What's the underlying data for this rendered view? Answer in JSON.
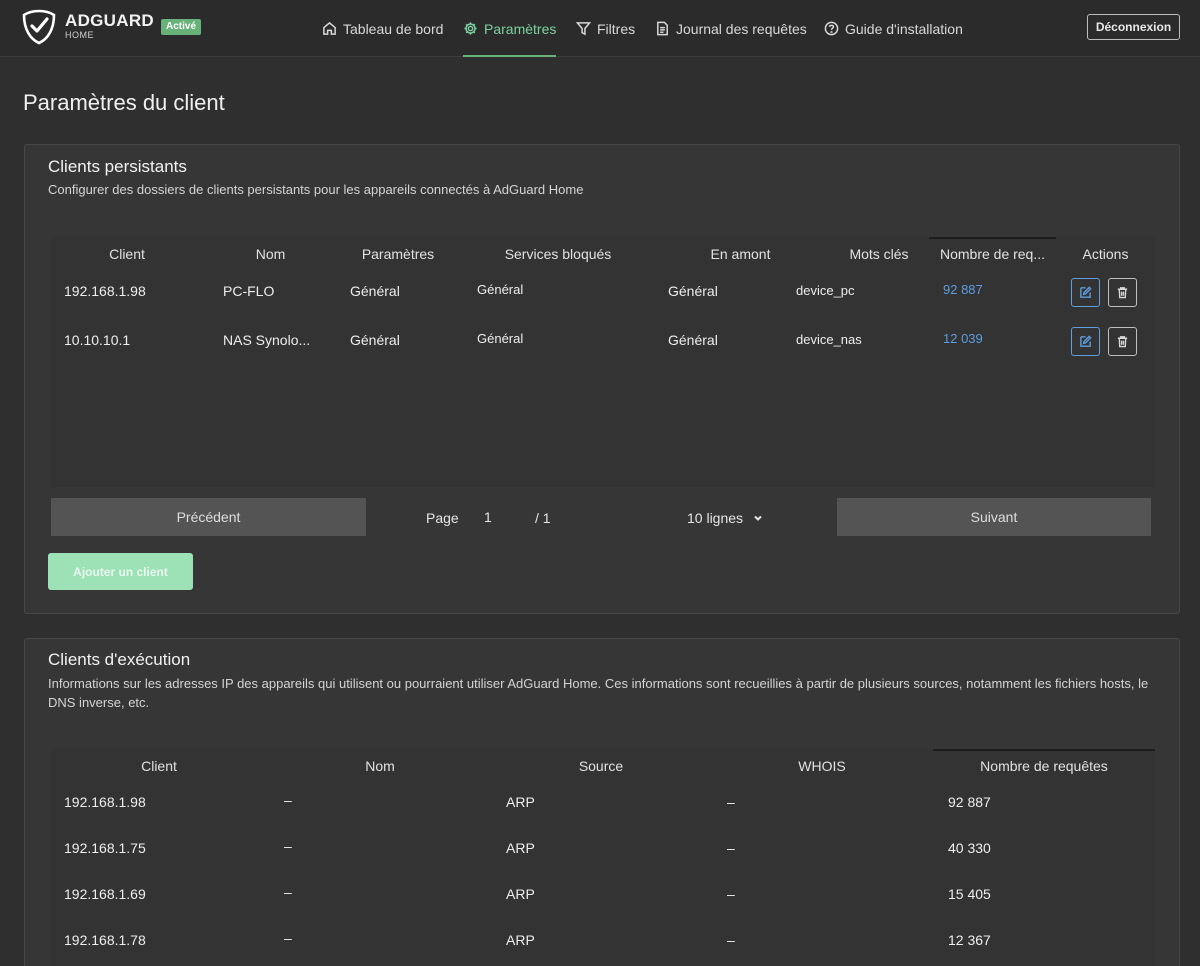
{
  "header": {
    "brand_name": "ADGUARD",
    "brand_sub": "HOME",
    "status_badge": "Activé",
    "nav": [
      {
        "label": "Tableau de bord",
        "icon": "home-icon"
      },
      {
        "label": "Paramètres",
        "icon": "gear-icon",
        "active": true
      },
      {
        "label": "Filtres",
        "icon": "filter-icon"
      },
      {
        "label": "Journal des requêtes",
        "icon": "document-icon"
      },
      {
        "label": "Guide d'installation",
        "icon": "help-icon"
      }
    ],
    "logout_label": "Déconnexion"
  },
  "page_title": "Paramètres du client",
  "persistent": {
    "title": "Clients persistants",
    "description": "Configurer des dossiers de clients persistants pour les appareils connectés à AdGuard Home",
    "columns": [
      "Client",
      "Nom",
      "Paramètres",
      "Services bloqués",
      "En amont",
      "Mots clés",
      "Nombre de req...",
      "Actions"
    ],
    "rows": [
      {
        "client": "192.168.1.98",
        "name": "PC-FLO",
        "settings": "Général",
        "blocked": "Général",
        "upstream": "Général",
        "tags": "device_pc",
        "requests": "92 887"
      },
      {
        "client": "10.10.10.1",
        "name": "NAS Synolo...",
        "settings": "Général",
        "blocked": "Général",
        "upstream": "Général",
        "tags": "device_nas",
        "requests": "12 039"
      }
    ],
    "pagination": {
      "prev_label": "Précédent",
      "page_label": "Page",
      "page_value": "1",
      "total": "/ 1",
      "rows_select": "10 lignes",
      "next_label": "Suivant"
    },
    "add_label": "Ajouter un client"
  },
  "runtime": {
    "title": "Clients d'exécution",
    "description": "Informations sur les adresses IP des appareils qui utilisent ou pourraient utiliser AdGuard Home. Ces informations sont recueillies à partir de plusieurs sources, notamment les fichiers hosts, le DNS inverse, etc.",
    "columns": [
      "Client",
      "Nom",
      "Source",
      "WHOIS",
      "Nombre de requêtes"
    ],
    "rows": [
      {
        "client": "192.168.1.98",
        "name": "–",
        "source": "ARP",
        "whois": "–",
        "requests": "92 887"
      },
      {
        "client": "192.168.1.75",
        "name": "–",
        "source": "ARP",
        "whois": "–",
        "requests": "40 330"
      },
      {
        "client": "192.168.1.69",
        "name": "–",
        "source": "ARP",
        "whois": "–",
        "requests": "15 405"
      },
      {
        "client": "192.168.1.78",
        "name": "–",
        "source": "ARP",
        "whois": "–",
        "requests": "12 367"
      }
    ]
  },
  "colors": {
    "accent": "#67b279",
    "link": "#5d9de0",
    "background": "#2f2f2f",
    "card": "#363636"
  }
}
